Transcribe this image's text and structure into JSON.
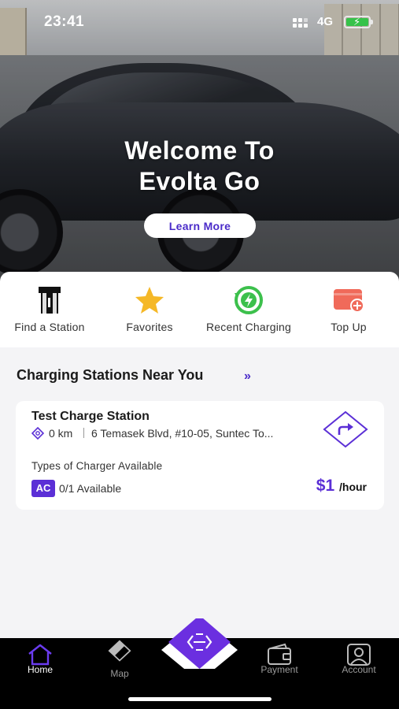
{
  "status_bar": {
    "time": "23:41",
    "network": "4G"
  },
  "hero": {
    "title_line1": "Welcome To",
    "title_line2": "Evolta Go",
    "cta_label": "Learn More"
  },
  "quick_actions": [
    {
      "label": "Find a Station",
      "icon": "charging-station-icon"
    },
    {
      "label": "Favorites",
      "icon": "star-icon"
    },
    {
      "label": "Recent Charging",
      "icon": "recent-charging-icon"
    },
    {
      "label": "Top Up",
      "icon": "wallet-add-icon"
    }
  ],
  "nearby": {
    "title": "Charging Stations Near You",
    "more_glyph": "»",
    "station": {
      "name": "Test Charge Station",
      "distance": "0 km",
      "address": "6 Temasek Blvd, #10-05, Suntec To...",
      "types_label": "Types of Charger Available",
      "charger_type": "AC",
      "availability": "0/1 Available",
      "price": "$1",
      "price_unit": "/hour"
    }
  },
  "bottom_nav": {
    "home": "Home",
    "map": "Map",
    "payment": "Payment",
    "account": "Account",
    "active": "Home"
  },
  "colors": {
    "accent": "#5b2fd6",
    "accent_dark": "#4a2bc9",
    "star": "#f5b827",
    "recent": "#3cc04c",
    "topup": "#f06a5a"
  }
}
